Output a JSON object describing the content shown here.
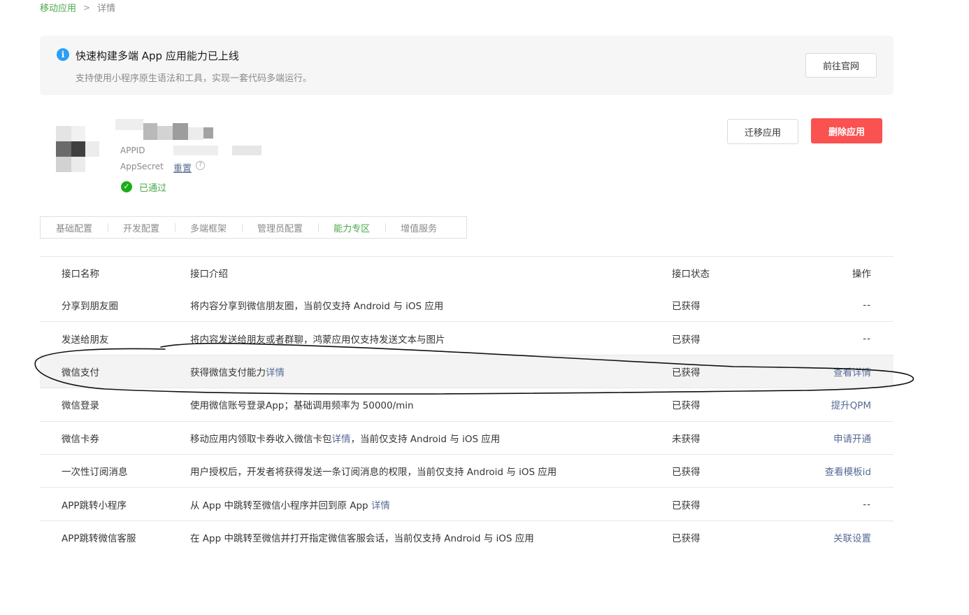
{
  "breadcrumb": {
    "parent": "移动应用",
    "separator": ">",
    "current": "详情"
  },
  "notice": {
    "icon": "info-icon",
    "title": "快速构建多端 App 应用能力已上线",
    "description": "支持使用小程序原生语法和工具，实现一套代码多端运行。",
    "button": "前往官网"
  },
  "app": {
    "appid_label": "APPID",
    "secret_label": "AppSecret",
    "reset_link": "重置",
    "status": "已通过"
  },
  "actions": {
    "migrate": "迁移应用",
    "delete": "删除应用"
  },
  "tabs": [
    {
      "label": "基础配置",
      "active": false
    },
    {
      "label": "开发配置",
      "active": false
    },
    {
      "label": "多端框架",
      "active": false
    },
    {
      "label": "管理员配置",
      "active": false
    },
    {
      "label": "能力专区",
      "active": true
    },
    {
      "label": "增值服务",
      "active": false
    }
  ],
  "table": {
    "headers": {
      "name": "接口名称",
      "desc": "接口介绍",
      "status": "接口状态",
      "op": "操作"
    },
    "rows": [
      {
        "name": "分享到朋友圈",
        "desc": "将内容分享到微信朋友圈，当前仅支持 Android 与 iOS 应用",
        "desc_link": "",
        "desc_suffix": "",
        "status": "已获得",
        "op": "--",
        "op_is_link": false
      },
      {
        "name": "发送给朋友",
        "desc": "将内容发送给朋友或者群聊，鸿蒙应用仅支持发送文本与图片",
        "desc_link": "",
        "desc_suffix": "",
        "status": "已获得",
        "op": "--",
        "op_is_link": false
      },
      {
        "name": "微信支付",
        "desc": "获得微信支付能力",
        "desc_link": "详情",
        "desc_suffix": "",
        "status": "已获得",
        "op": "查看详情",
        "op_is_link": true
      },
      {
        "name": "微信登录",
        "desc": "使用微信账号登录App；基础调用频率为 50000/min",
        "desc_link": "",
        "desc_suffix": "",
        "status": "已获得",
        "op": "提升QPM",
        "op_is_link": true
      },
      {
        "name": "微信卡券",
        "desc": "移动应用内领取卡券收入微信卡包",
        "desc_link": "详情",
        "desc_suffix": "，当前仅支持 Android 与 iOS 应用",
        "status": "未获得",
        "op": "申请开通",
        "op_is_link": true
      },
      {
        "name": "一次性订阅消息",
        "desc": "用户授权后，开发者将获得发送一条订阅消息的权限，当前仅支持 Android 与 iOS 应用",
        "desc_link": "",
        "desc_suffix": "",
        "status": "已获得",
        "op": "查看模板id",
        "op_is_link": true
      },
      {
        "name": "APP跳转小程序",
        "desc": "从 App 中跳转至微信小程序并回到原 App ",
        "desc_link": "详情",
        "desc_suffix": "",
        "status": "已获得",
        "op": "--",
        "op_is_link": false
      },
      {
        "name": "APP跳转微信客服",
        "desc": "在 App 中跳转至微信并打开指定微信客服会话，当前仅支持 Android 与 iOS 应用",
        "desc_link": "",
        "desc_suffix": "",
        "status": "已获得",
        "op": "关联设置",
        "op_is_link": true
      }
    ],
    "highlighted_row": 2
  },
  "colors": {
    "accent_green": "#4ba84b",
    "link_blue": "#576b95",
    "danger_red": "#fa5151",
    "info_blue": "#2a9ff5"
  }
}
